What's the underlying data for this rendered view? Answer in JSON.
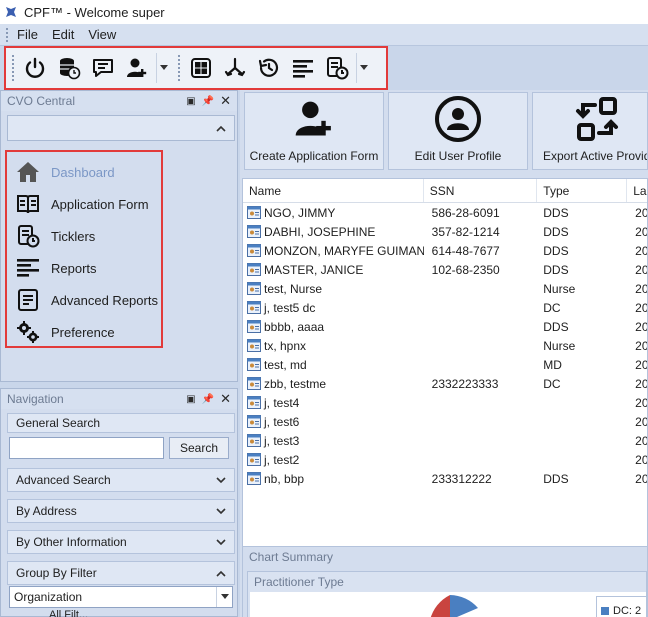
{
  "window": {
    "title": "CPF™  -  Welcome super"
  },
  "menu": [
    "File",
    "Edit",
    "View"
  ],
  "toolbar": {
    "buttons": [
      "power-icon",
      "database-clock-icon",
      "message-icon",
      "add-user-icon",
      "dropdown",
      "grid-icon",
      "merge-icon",
      "history-icon",
      "align-left-icon",
      "database-clock-icon",
      "dropdown"
    ]
  },
  "cvo": {
    "title": "CVO Central",
    "items": [
      {
        "label": "Dashboard",
        "icon": "home-icon",
        "active": true
      },
      {
        "label": "Application Form",
        "icon": "book-icon"
      },
      {
        "label": "Ticklers",
        "icon": "tickler-icon"
      },
      {
        "label": "Reports",
        "icon": "lines-icon"
      },
      {
        "label": "Advanced Reports",
        "icon": "report-icon"
      },
      {
        "label": "Preference",
        "icon": "gears-icon"
      }
    ]
  },
  "navigation": {
    "title": "Navigation",
    "general_search": "General Search",
    "search_value": "",
    "search_button": "Search",
    "sections": [
      "Advanced Search",
      "By Address",
      "By Other Information",
      "Group By Filter"
    ],
    "filter_value": "Organization",
    "tree_first": "All Filt..."
  },
  "actions": [
    {
      "label": "Create Application Form",
      "icon": "add-user-icon"
    },
    {
      "label": "Edit User Profile",
      "icon": "user-circle-icon"
    },
    {
      "label": "Export Active Provid",
      "icon": "export-icon"
    }
  ],
  "grid": {
    "columns": [
      "Name",
      "SSN",
      "Type",
      "La"
    ],
    "rows": [
      {
        "name": "NGO, JIMMY",
        "ssn": "586-28-6091",
        "type": "DDS",
        "last": "20"
      },
      {
        "name": "DABHI, JOSEPHINE",
        "ssn": "357-82-1214",
        "type": "DDS",
        "last": "20"
      },
      {
        "name": "MONZON, MARYFE GUIMAN",
        "ssn": "614-48-7677",
        "type": "DDS",
        "last": "20"
      },
      {
        "name": "MASTER, JANICE",
        "ssn": "102-68-2350",
        "type": "DDS",
        "last": "20"
      },
      {
        "name": "test, Nurse",
        "ssn": "",
        "type": "Nurse",
        "last": "20"
      },
      {
        "name": "j, test5 dc",
        "ssn": "",
        "type": "DC",
        "last": "20"
      },
      {
        "name": "bbbb, aaaa",
        "ssn": "",
        "type": "DDS",
        "last": "20"
      },
      {
        "name": "tx, hpnx",
        "ssn": "",
        "type": "Nurse",
        "last": "20"
      },
      {
        "name": "test, md",
        "ssn": "",
        "type": "MD",
        "last": "20"
      },
      {
        "name": "zbb, testme",
        "ssn": "2332223333",
        "type": "DC",
        "last": "20"
      },
      {
        "name": "j, test4",
        "ssn": "",
        "type": "",
        "last": "20"
      },
      {
        "name": "j, test6",
        "ssn": "",
        "type": "",
        "last": "20"
      },
      {
        "name": "j, test3",
        "ssn": "",
        "type": "",
        "last": "20"
      },
      {
        "name": "j, test2",
        "ssn": "",
        "type": "",
        "last": "20"
      },
      {
        "name": "nb, bbp",
        "ssn": "233312222",
        "type": "DDS",
        "last": "20"
      }
    ]
  },
  "chart_summary": {
    "title": "Chart Summary",
    "panel_title": "Practitioner Type",
    "legend_label": "DC: 2"
  },
  "colors": {
    "highlight_border": "#e23a3a",
    "panel_bg": "#d3ddee",
    "active_item": "#7b97c6"
  }
}
